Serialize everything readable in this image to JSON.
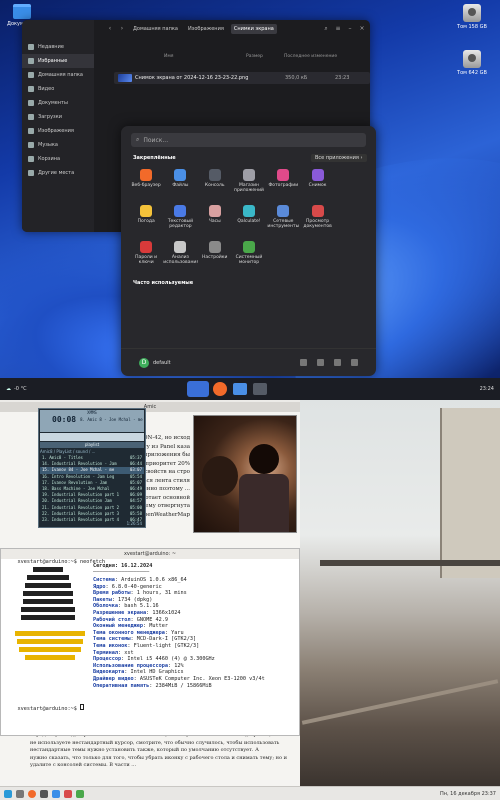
{
  "top": {
    "desktop_icons": [
      {
        "label": "Документы"
      },
      {
        "label": "Том 158 GB"
      },
      {
        "label": "Том 642 GB"
      }
    ],
    "file_manager": {
      "breadcrumb": [
        "Домашняя папка",
        "Изображения",
        "Снимки экрана"
      ],
      "sidebar": [
        {
          "label": "Недавние"
        },
        {
          "label": "Избранные"
        },
        {
          "label": "Домашняя папка"
        },
        {
          "label": "Видео"
        },
        {
          "label": "Документы"
        },
        {
          "label": "Загрузки"
        },
        {
          "label": "Изображения"
        },
        {
          "label": "Музыка"
        },
        {
          "label": "Корзина"
        },
        {
          "label": "Другие места"
        }
      ],
      "columns": {
        "name": "Имя",
        "size": "Размер",
        "modified": "Последнее изменение"
      },
      "file": {
        "name": "Снимок экрана от 2024-12-16 23-23-22.png",
        "size": "350,0 кБ",
        "time": "23:23"
      }
    },
    "app_menu": {
      "search_placeholder": "Поиск...",
      "pinned_title": "Закреплённые",
      "all_apps_label": "Все приложения",
      "frequent_title": "Часто используемые",
      "user_initial": "D",
      "user_name": "default",
      "apps": [
        {
          "label": "Веб-браузер",
          "color": "#f26a2a"
        },
        {
          "label": "Файлы",
          "color": "#4a8fe6"
        },
        {
          "label": "Консоль",
          "color": "#555b66"
        },
        {
          "label": "Магазин приложений",
          "color": "#9e9ea6"
        },
        {
          "label": "Фотографии",
          "color": "#e04a8a"
        },
        {
          "label": "Снимок",
          "color": "#8a5ad8"
        },
        {
          "label": "",
          "color": "transparent"
        },
        {
          "label": "Погода",
          "color": "#f4c23a"
        },
        {
          "label": "Текстовый редактор",
          "color": "#4a7ae6"
        },
        {
          "label": "Часы",
          "color": "#d8a0a0"
        },
        {
          "label": "Qalculate!",
          "color": "#3ab8c8"
        },
        {
          "label": "Сетевые инструменты",
          "color": "#5a8ad8"
        },
        {
          "label": "Просмотр документов",
          "color": "#d84a4a"
        },
        {
          "label": "",
          "color": "transparent"
        },
        {
          "label": "Пароли и ключи",
          "color": "#d83a3a"
        },
        {
          "label": "Анализ использования",
          "color": "#c8c8c8"
        },
        {
          "label": "Настройки",
          "color": "#8a8a8a"
        },
        {
          "label": "Системный монитор",
          "color": "#4aa84a"
        }
      ]
    },
    "taskbar": {
      "weather": "-0 °C",
      "clock": "23:24"
    }
  },
  "bottom": {
    "doc_title": "Amic",
    "doc_lines_top": [
      "MSDN-42, но исход",
      "цитату из Panel каза",
      "ь! Почти все приложения бы",
      "есткой. Если не указано приоритет 20%",
      "ие поддержка свойств на стро",
      "д! Может прокручиваться лента стиля",
      "MS-DOS-код. Именно поэтому ...",
      "стрелки. Она работает основной",
      "ли всё плохо. Вот всему отвергнута",
      "и OpenWeatherMap"
    ],
    "doc_bottom_lines": [
      "передвинуть вид) справа от окна появится полоса (или на установке и отлажено), пройти, чтобы",
      "не используете нестандартный курсор, смотрите, что обычно случилось, чтобы использовать",
      "нестандартные темы нужно установить также, который по умолчанию отсутствует. А",
      "нужно сказать, что только для того, чтобы убрать иконку с рабочего стола и снимать тему; но и",
      "удалите с консолей системы. В части ..."
    ],
    "player": {
      "title": "XMMS",
      "time": "00:08",
      "track_line": "8. Amic 8 - Joe Mchal - me",
      "playlist_title": "playlist",
      "header": "Amic8 / PlayList / sound / ...",
      "rows": [
        {
          "title": "1. Amic8 - Titles",
          "time": "05:37"
        },
        {
          "title": "14. Industrial Revolution - Jam",
          "time": "06:44"
        },
        {
          "title": "15. Ivanov 84 - Joe Mchal - me",
          "time": "03:07"
        },
        {
          "title": "16. Intro Revolution - Jam Leg",
          "time": "05:54"
        },
        {
          "title": "17. Ivanov Revolution - Jam",
          "time": "05:07"
        },
        {
          "title": "18. Bass Machine - Joe Mchal",
          "time": "06:49"
        },
        {
          "title": "19. Industrial Revolution part 1",
          "time": "06:09"
        },
        {
          "title": "20. Industrial Revolution Jam",
          "time": "04:57"
        },
        {
          "title": "21. Industrial Revolution part 2",
          "time": "05:00"
        },
        {
          "title": "22. Industrial Revolution part 3",
          "time": "05:58"
        },
        {
          "title": "23. Industrial Revolution part 4",
          "time": "06:47"
        }
      ],
      "total": "1:26:54"
    },
    "terminal": {
      "title": "xvestart@arduino: ~",
      "prompt": "xvestart@arduino:~$ ",
      "command": "neofetch",
      "header": "Сегодня: 16.12.2024",
      "info": [
        {
          "k": "Система",
          "v": "ArduinOS 1.0.6 x86_64"
        },
        {
          "k": "Ядро",
          "v": "6.8.0-40-generic"
        },
        {
          "k": "Время работы",
          "v": "1 hours, 31 mins"
        },
        {
          "k": "Пакеты",
          "v": "1734 (dpkg)"
        },
        {
          "k": "Оболочка",
          "v": "bash 5.1.16"
        },
        {
          "k": "Разрешение экрана",
          "v": "1366x1024"
        },
        {
          "k": "Рабочий стол",
          "v": "GNOME 42.9"
        },
        {
          "k": "Оконный менеджер",
          "v": "Mutter"
        },
        {
          "k": "Тема оконного менеджера",
          "v": "Yaru"
        },
        {
          "k": "Тема системы",
          "v": "MCD-Dark-I [GTK2/3]"
        },
        {
          "k": "Тема иконок",
          "v": "Fluent-light [GTK2/3]"
        },
        {
          "k": "Терминал",
          "v": "xst"
        },
        {
          "k": "Процессор",
          "v": "Intel i5 4460 (4) @ 3.300GHz"
        },
        {
          "k": "Использование процессора",
          "v": "12%"
        },
        {
          "k": "Видеокарта",
          "v": "Intel HD Graphics"
        },
        {
          "k": "Драйвер видео",
          "v": "ASUSTeK Computer Inc. Xeon E3-1200 v3/4t"
        },
        {
          "k": "Оперативная память",
          "v": "2384MiB / 15866MiB"
        }
      ],
      "prompt2": "xvestart@arduino:~$ "
    },
    "taskbar": {
      "clock": "Пн, 16 декабря 23:37"
    }
  }
}
